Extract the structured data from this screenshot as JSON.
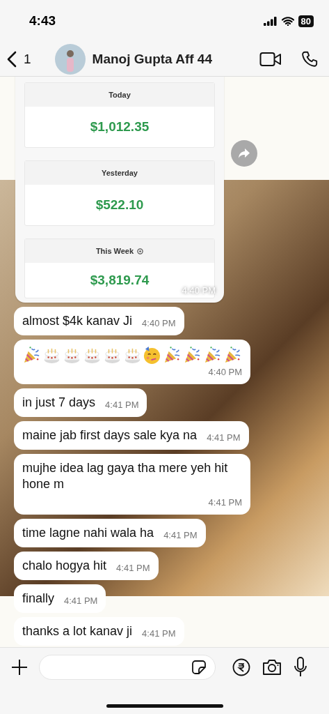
{
  "status_bar": {
    "time": "4:43",
    "battery": "80"
  },
  "header": {
    "back_count": "1",
    "contact_name": "Manoj Gupta Aff 44"
  },
  "shared_screenshot": {
    "time": "4:40 PM",
    "stats": [
      {
        "label": "Today",
        "value": "$1,012.35",
        "info": false
      },
      {
        "label": "Yesterday",
        "value": "$522.10",
        "info": false
      },
      {
        "label": "This Week",
        "value": "$3,819.74",
        "info": true
      }
    ]
  },
  "messages": [
    {
      "kind": "text",
      "text": "almost $4k kanav Ji",
      "time": "4:40 PM"
    },
    {
      "kind": "emoji",
      "emojis": [
        {
          "kind": "party-popper"
        },
        {
          "kind": "cake"
        },
        {
          "kind": "cake"
        },
        {
          "kind": "cake"
        },
        {
          "kind": "cake"
        },
        {
          "kind": "cake"
        },
        {
          "kind": "party-face"
        },
        {
          "kind": "party-popper"
        },
        {
          "kind": "party-popper"
        },
        {
          "kind": "party-popper"
        },
        {
          "kind": "party-popper"
        }
      ],
      "time": "4:40 PM"
    },
    {
      "kind": "text",
      "text": "in just 7 days",
      "time": "4:41 PM"
    },
    {
      "kind": "text",
      "text": "maine jab first days sale kya na",
      "time": "4:41 PM"
    },
    {
      "kind": "text",
      "text": "mujhe idea lag gaya tha mere yeh hit hone m",
      "time": "4:41 PM"
    },
    {
      "kind": "text",
      "text": "time lagne nahi wala ha",
      "time": "4:41 PM"
    },
    {
      "kind": "text",
      "text": "chalo hogya hit",
      "time": "4:41 PM"
    },
    {
      "kind": "text",
      "text": "finally",
      "time": "4:41 PM"
    },
    {
      "kind": "text",
      "text": "thanks a lot kanav ji",
      "time": "4:41 PM"
    }
  ]
}
